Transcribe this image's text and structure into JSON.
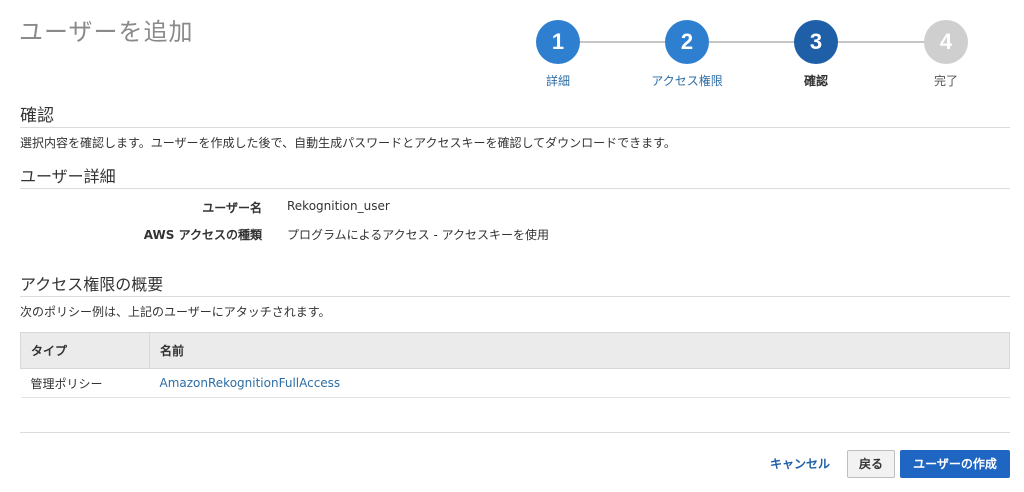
{
  "page_title": "ユーザーを追加",
  "steps": [
    {
      "number": "1",
      "label": "詳細",
      "state": "done"
    },
    {
      "number": "2",
      "label": "アクセス権限",
      "state": "done"
    },
    {
      "number": "3",
      "label": "確認",
      "state": "current"
    },
    {
      "number": "4",
      "label": "完了",
      "state": "future"
    }
  ],
  "review": {
    "heading": "確認",
    "description": "選択内容を確認します。ユーザーを作成した後で、自動生成パスワードとアクセスキーを確認してダウンロードできます。"
  },
  "user_details": {
    "heading": "ユーザー詳細",
    "rows": [
      {
        "label": "ユーザー名",
        "value": "Rekognition_user"
      },
      {
        "label": "AWS アクセスの種類",
        "value": "プログラムによるアクセス - アクセスキーを使用"
      }
    ]
  },
  "permissions": {
    "heading": "アクセス権限の概要",
    "description": "次のポリシー例は、上記のユーザーにアタッチされます。",
    "columns": [
      "タイプ",
      "名前"
    ],
    "rows": [
      {
        "type": "管理ポリシー",
        "name": "AmazonRekognitionFullAccess"
      }
    ]
  },
  "actions": {
    "cancel": "キャンセル",
    "back": "戻る",
    "create": "ユーザーの作成"
  },
  "colors": {
    "step_done": "#2f7fd1",
    "step_current": "#1f5fa8",
    "step_future": "#cfcfcf",
    "link": "#2e6da4",
    "primary_button": "#1f66c2"
  }
}
